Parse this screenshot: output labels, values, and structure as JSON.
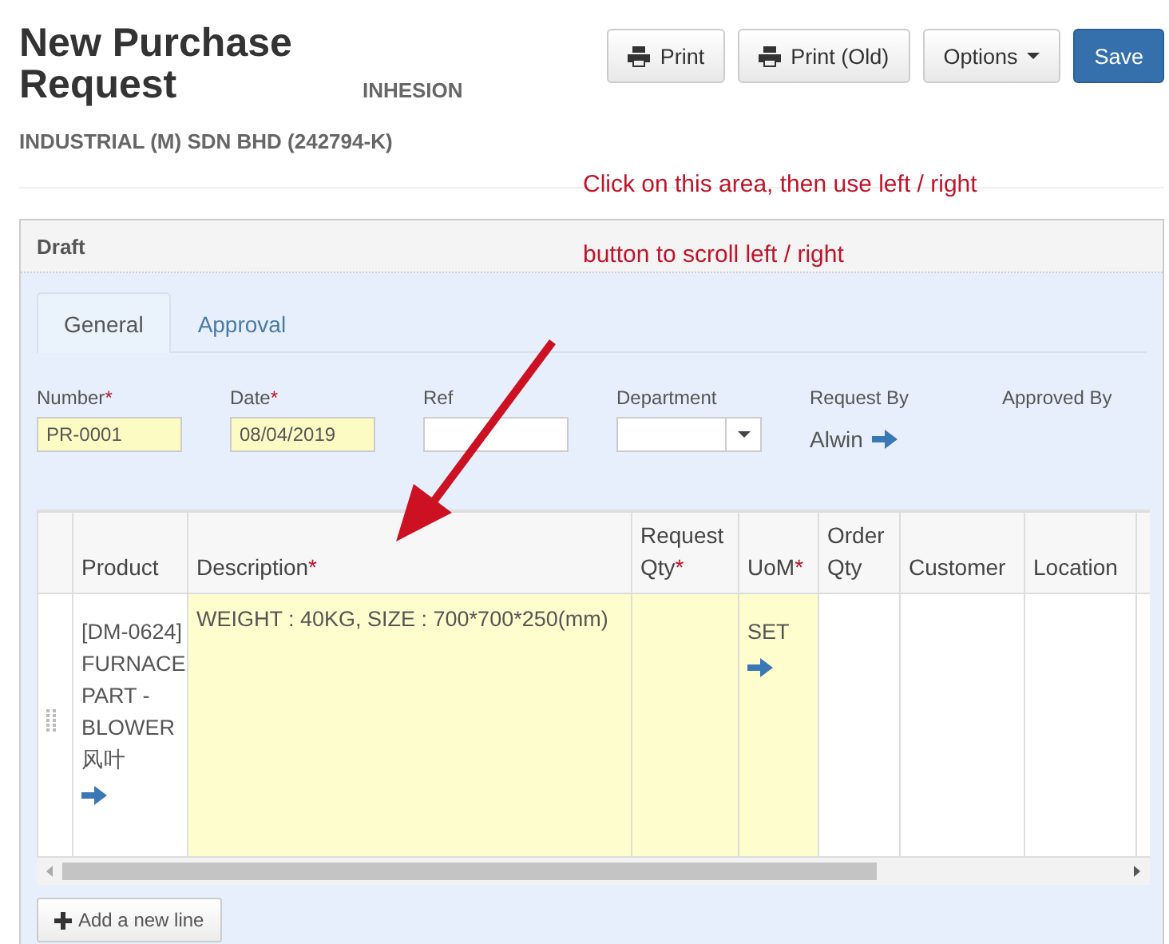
{
  "header": {
    "title": "New Purchase Request",
    "company": "INHESION INDUSTRIAL (M) SDN BHD (242794-K)"
  },
  "buttons": [
    {
      "label": "Print",
      "kind": "print"
    },
    {
      "label": "Print (Old)",
      "kind": "print"
    },
    {
      "label": "Options",
      "kind": "dropdown"
    },
    {
      "label": "Save",
      "kind": "primary"
    }
  ],
  "annotations": [
    "Click on this area, then use left / right",
    "button to scroll left / right"
  ],
  "panel": {
    "status": "Draft"
  },
  "tabs": [
    {
      "label": "General",
      "selected": true
    },
    {
      "label": "Approval",
      "selected": false
    }
  ],
  "fields": [
    {
      "label": "Number",
      "mark": "*",
      "kind": "input",
      "value": "PR-0001",
      "required": true
    },
    {
      "label": "Date",
      "mark": "*",
      "kind": "input",
      "value": "08/04/2019",
      "required": true
    },
    {
      "label": "Ref",
      "kind": "input",
      "required": false
    },
    {
      "label": "Department",
      "kind": "select"
    },
    {
      "label": "Request By",
      "kind": "link",
      "value": "Alwin"
    },
    {
      "label": "Approved By",
      "kind": "text"
    }
  ],
  "table": {
    "columns": [
      {
        "label": "Product"
      },
      {
        "label": "Description",
        "mark": "*"
      },
      {
        "label": "Request Qty",
        "mark": "*"
      },
      {
        "label": "UoM",
        "mark": "*"
      },
      {
        "label": "Order Qty"
      },
      {
        "label": "Customer"
      },
      {
        "label": "Location"
      }
    ],
    "rows": [
      {
        "cells": [
          {
            "text": "[DM-0624] FURNACE PART - BLOWER 风叶",
            "link": true,
            "required": false
          },
          {
            "text": "WEIGHT : 40KG, SIZE : 700*700*250(mm)",
            "link": false,
            "required": true
          },
          {
            "text": "",
            "link": false,
            "required": true
          },
          {
            "text": "SET",
            "link": true,
            "required": true
          },
          {
            "text": "",
            "link": false,
            "required": false
          },
          {
            "text": "",
            "link": false,
            "required": false
          },
          {
            "text": "",
            "link": false,
            "required": false
          }
        ]
      }
    ]
  },
  "add_line": {
    "label": "Add a new line"
  }
}
